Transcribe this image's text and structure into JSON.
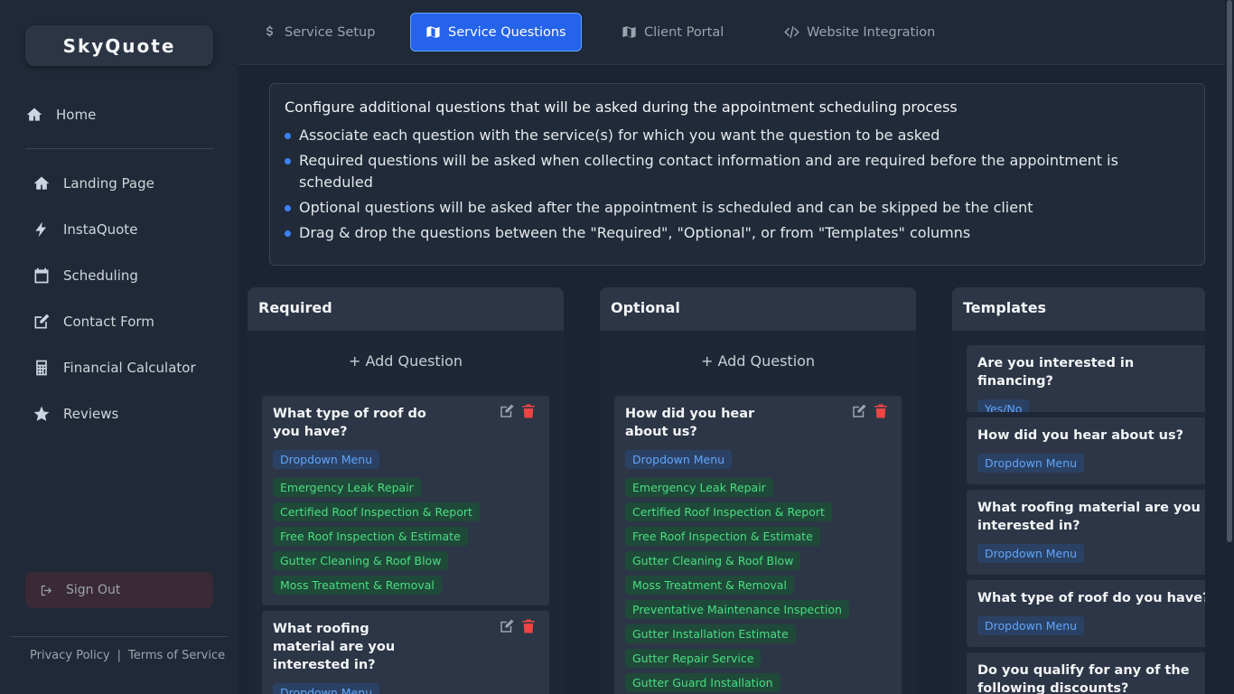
{
  "app": {
    "logo": "SkyQuote"
  },
  "sidebar": {
    "home": "Home",
    "items": [
      {
        "label": "Landing Page",
        "icon": "home-icon"
      },
      {
        "label": "InstaQuote",
        "icon": "bolt-icon"
      },
      {
        "label": "Scheduling",
        "icon": "calendar-icon"
      },
      {
        "label": "Contact Form",
        "icon": "edit-icon"
      },
      {
        "label": "Financial Calculator",
        "icon": "calculator-icon"
      },
      {
        "label": "Reviews",
        "icon": "star-icon"
      }
    ],
    "signout": "Sign Out",
    "footer": {
      "privacy": "Privacy Policy",
      "sep": "|",
      "terms": "Terms of Service"
    }
  },
  "tabs": [
    {
      "label": "Service Setup",
      "icon": "dollar-icon",
      "active": false
    },
    {
      "label": "Service Questions",
      "icon": "map-icon",
      "active": true
    },
    {
      "label": "Client Portal",
      "icon": "map-icon",
      "active": false
    },
    {
      "label": "Website Integration",
      "icon": "code-icon",
      "active": false
    }
  ],
  "info": {
    "heading": "Configure additional questions that will be asked during the appointment scheduling process",
    "bullets": [
      "Associate each question with the service(s) for which you want the question to be asked",
      "Required questions will be asked when collecting contact information and are required before the appointment is scheduled",
      "Optional questions will be asked after the appointment is scheduled and can be skipped be the client",
      "Drag & drop the questions between the \"Required\", \"Optional\", or from \"Templates\" columns"
    ]
  },
  "columns": {
    "required": {
      "title": "Required",
      "add_label": "Add Question",
      "cards": [
        {
          "title": "What type of roof do you have?",
          "type": "Dropdown Menu",
          "services": [
            "Emergency Leak Repair",
            "Certified Roof Inspection & Report",
            "Free Roof Inspection & Estimate",
            "Gutter Cleaning & Roof Blow",
            "Moss Treatment & Removal"
          ]
        },
        {
          "title": "What roofing material are you interested in?",
          "type": "Dropdown Menu",
          "services": []
        }
      ]
    },
    "optional": {
      "title": "Optional",
      "add_label": "Add Question",
      "cards": [
        {
          "title": "How did you hear about us?",
          "type": "Dropdown Menu",
          "services": [
            "Emergency Leak Repair",
            "Certified Roof Inspection & Report",
            "Free Roof Inspection & Estimate",
            "Gutter Cleaning & Roof Blow",
            "Moss Treatment & Removal",
            "Preventative Maintenance Inspection",
            "Gutter Installation Estimate",
            "Gutter Repair Service",
            "Gutter Guard Installation"
          ]
        }
      ]
    },
    "templates": {
      "title": "Templates",
      "cards": [
        {
          "title": "Are you interested in financing?",
          "type": "Yes/No"
        },
        {
          "title": "How did you hear about us?",
          "type": "Dropdown Menu"
        },
        {
          "title": "What roofing material are you interested in?",
          "type": "Dropdown Menu"
        },
        {
          "title": "What type of roof do you have?",
          "type": "Dropdown Menu"
        },
        {
          "title": "Do you qualify for any of the following discounts?",
          "type": ""
        }
      ]
    }
  },
  "colors": {
    "accent": "#2563eb",
    "tag_green": "#4ade80",
    "tag_blue": "#60a5fa",
    "delete": "#ef4444"
  }
}
